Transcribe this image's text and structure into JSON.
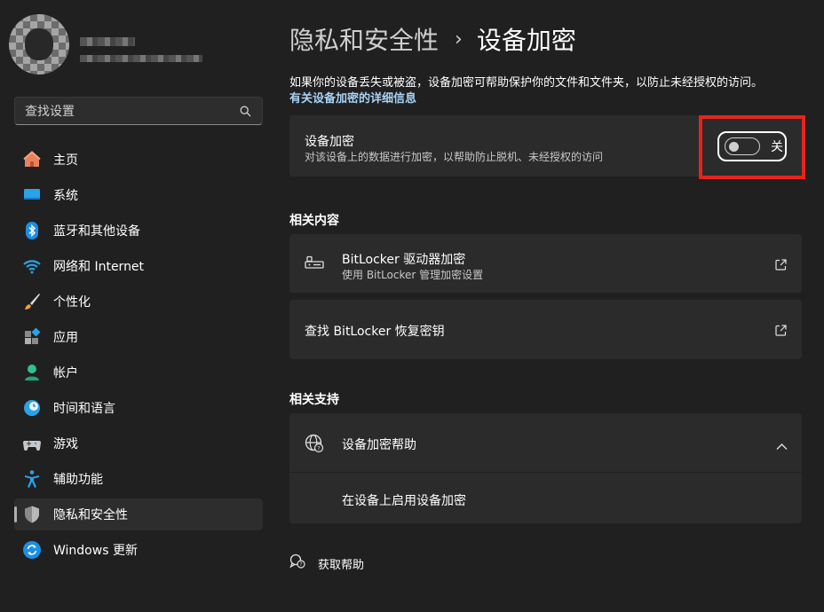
{
  "sidebar": {
    "search_placeholder": "查找设置",
    "items": [
      {
        "label": "主页",
        "icon": "home-icon"
      },
      {
        "label": "系统",
        "icon": "system-icon"
      },
      {
        "label": "蓝牙和其他设备",
        "icon": "bluetooth-icon"
      },
      {
        "label": "网络和 Internet",
        "icon": "wifi-icon"
      },
      {
        "label": "个性化",
        "icon": "brush-icon"
      },
      {
        "label": "应用",
        "icon": "apps-icon"
      },
      {
        "label": "帐户",
        "icon": "account-icon"
      },
      {
        "label": "时间和语言",
        "icon": "clock-globe-icon"
      },
      {
        "label": "游戏",
        "icon": "gamepad-icon"
      },
      {
        "label": "辅助功能",
        "icon": "accessibility-icon"
      },
      {
        "label": "隐私和安全性",
        "icon": "shield-icon",
        "active": true
      },
      {
        "label": "Windows 更新",
        "icon": "update-icon"
      }
    ]
  },
  "header": {
    "parent": "隐私和安全性",
    "separator": "›",
    "current": "设备加密"
  },
  "main": {
    "description": "如果你的设备丢失或被盗，设备加密可帮助保护你的文件和文件夹，以防止未经授权的访问。",
    "learn_more": "有关设备加密的详细信息",
    "encryption_card": {
      "title": "设备加密",
      "subtitle": "对该设备上的数据进行加密，以帮助防止脱机、未经授权的访问",
      "toggle_state": "关",
      "toggle_on": false
    },
    "related_content": {
      "title": "相关内容",
      "bitlocker_title": "BitLocker 驱动器加密",
      "bitlocker_subtitle": "使用 BitLocker 管理加密设置",
      "recovery_title": "查找 BitLocker 恢复密钥"
    },
    "related_support": {
      "title": "相关支持",
      "help_title": "设备加密帮助",
      "help_link": "在设备上启用设备加密"
    },
    "get_help": "获取帮助"
  },
  "colors": {
    "background": "#202020",
    "card": "#2b2b2b",
    "highlight": "#e8231b",
    "link": "#a8d3f5"
  }
}
